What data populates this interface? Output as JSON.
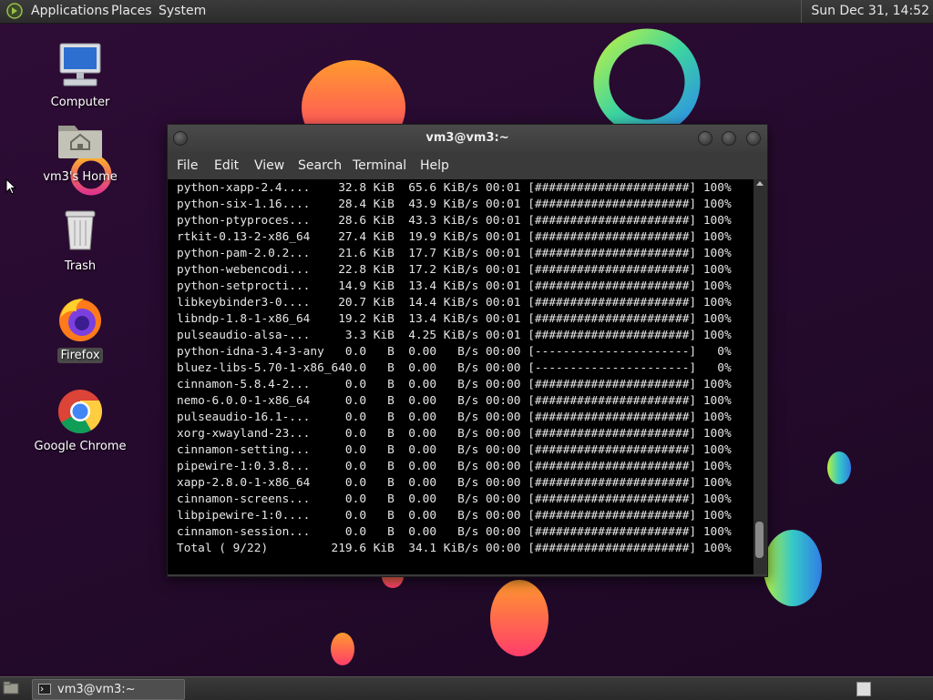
{
  "top_panel": {
    "menus": [
      "Applications",
      "Places",
      "System"
    ],
    "clock": "Sun Dec 31, 14:52"
  },
  "desktop_icons": [
    {
      "label": "Computer"
    },
    {
      "label": "vm3's Home"
    },
    {
      "label": "Trash"
    },
    {
      "label": "Firefox"
    },
    {
      "label": "Google Chrome"
    }
  ],
  "terminal": {
    "title": "vm3@vm3:~",
    "menus": [
      "File",
      "Edit",
      "View",
      "Search",
      "Terminal",
      "Help"
    ],
    "lines": [
      "python-xapp-2.4....    32.8 KiB  65.6 KiB/s 00:01 [######################] 100%",
      "python-six-1.16....    28.4 KiB  43.9 KiB/s 00:01 [######################] 100%",
      "python-ptyproces...    28.6 KiB  43.3 KiB/s 00:01 [######################] 100%",
      "rtkit-0.13-2-x86_64    27.4 KiB  19.9 KiB/s 00:01 [######################] 100%",
      "python-pam-2.0.2...    21.6 KiB  17.7 KiB/s 00:01 [######################] 100%",
      "python-webencodi...    22.8 KiB  17.2 KiB/s 00:01 [######################] 100%",
      "python-setprocti...    14.9 KiB  13.4 KiB/s 00:01 [######################] 100%",
      "libkeybinder3-0....    20.7 KiB  14.4 KiB/s 00:01 [######################] 100%",
      "libndp-1.8-1-x86_64    19.2 KiB  13.4 KiB/s 00:01 [######################] 100%",
      "pulseaudio-alsa-...     3.3 KiB  4.25 KiB/s 00:01 [######################] 100%",
      "python-idna-3.4-3-any   0.0   B  0.00   B/s 00:00 [----------------------]   0%",
      "bluez-libs-5.70-1-x86_640.0   B  0.00   B/s 00:00 [----------------------]   0%",
      "cinnamon-5.8.4-2...     0.0   B  0.00   B/s 00:00 [######################] 100%",
      "nemo-6.0.0-1-x86_64     0.0   B  0.00   B/s 00:00 [######################] 100%",
      "pulseaudio-16.1-...     0.0   B  0.00   B/s 00:00 [######################] 100%",
      "xorg-xwayland-23...     0.0   B  0.00   B/s 00:00 [######################] 100%",
      "cinnamon-setting...     0.0   B  0.00   B/s 00:00 [######################] 100%",
      "pipewire-1:0.3.8...     0.0   B  0.00   B/s 00:00 [######################] 100%",
      "xapp-2.8.0-1-x86_64     0.0   B  0.00   B/s 00:00 [######################] 100%",
      "cinnamon-screens...     0.0   B  0.00   B/s 00:00 [######################] 100%",
      "libpipewire-1:0....     0.0   B  0.00   B/s 00:00 [######################] 100%",
      "cinnamon-session...     0.0   B  0.00   B/s 00:00 [######################] 100%",
      "Total ( 9/22)         219.6 KiB  34.1 KiB/s 00:00 [######################] 100%"
    ]
  },
  "taskbar": {
    "task_label": "vm3@vm3:~"
  }
}
